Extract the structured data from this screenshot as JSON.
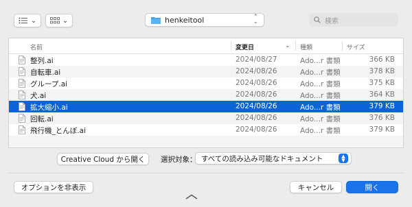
{
  "toolbar": {
    "view_list_icon": "list-icon",
    "view_grid_icon": "grid-icon",
    "location": "henkeitool",
    "search_placeholder": "検索"
  },
  "columns": {
    "name": "名前",
    "date": "変更日",
    "type": "種類",
    "size": "サイズ"
  },
  "files": [
    {
      "name": "整列.ai",
      "date": "2024/08/27",
      "type": "Ado...r 書類",
      "size": "366 KB",
      "selected": false
    },
    {
      "name": "自転車.ai",
      "date": "2024/08/26",
      "type": "Ado...r 書類",
      "size": "378 KB",
      "selected": false
    },
    {
      "name": "グループ.ai",
      "date": "2024/08/26",
      "type": "Ado...r 書類",
      "size": "375 KB",
      "selected": false
    },
    {
      "name": "犬.ai",
      "date": "2024/08/26",
      "type": "Ado...r 書類",
      "size": "364 KB",
      "selected": false
    },
    {
      "name": "拡大縮小.ai",
      "date": "2024/08/26",
      "type": "Ado...r 書類",
      "size": "379 KB",
      "selected": true
    },
    {
      "name": "回転.ai",
      "date": "2024/08/26",
      "type": "Ado...r 書類",
      "size": "376 KB",
      "selected": false
    },
    {
      "name": "飛行機_とんぼ.ai",
      "date": "2024/08/26",
      "type": "Ado...r 書類",
      "size": "379 KB",
      "selected": false
    }
  ],
  "bottom": {
    "cc_button": "Creative Cloud から開く",
    "filter_label": "選択対象：",
    "filter_value": "すべての読み込み可能なドキュメント",
    "options_button": "オプションを非表示",
    "cancel_button": "キャンセル",
    "open_button": "開く"
  },
  "colors": {
    "accent": "#1a73e8",
    "selection": "#0a64d8"
  }
}
